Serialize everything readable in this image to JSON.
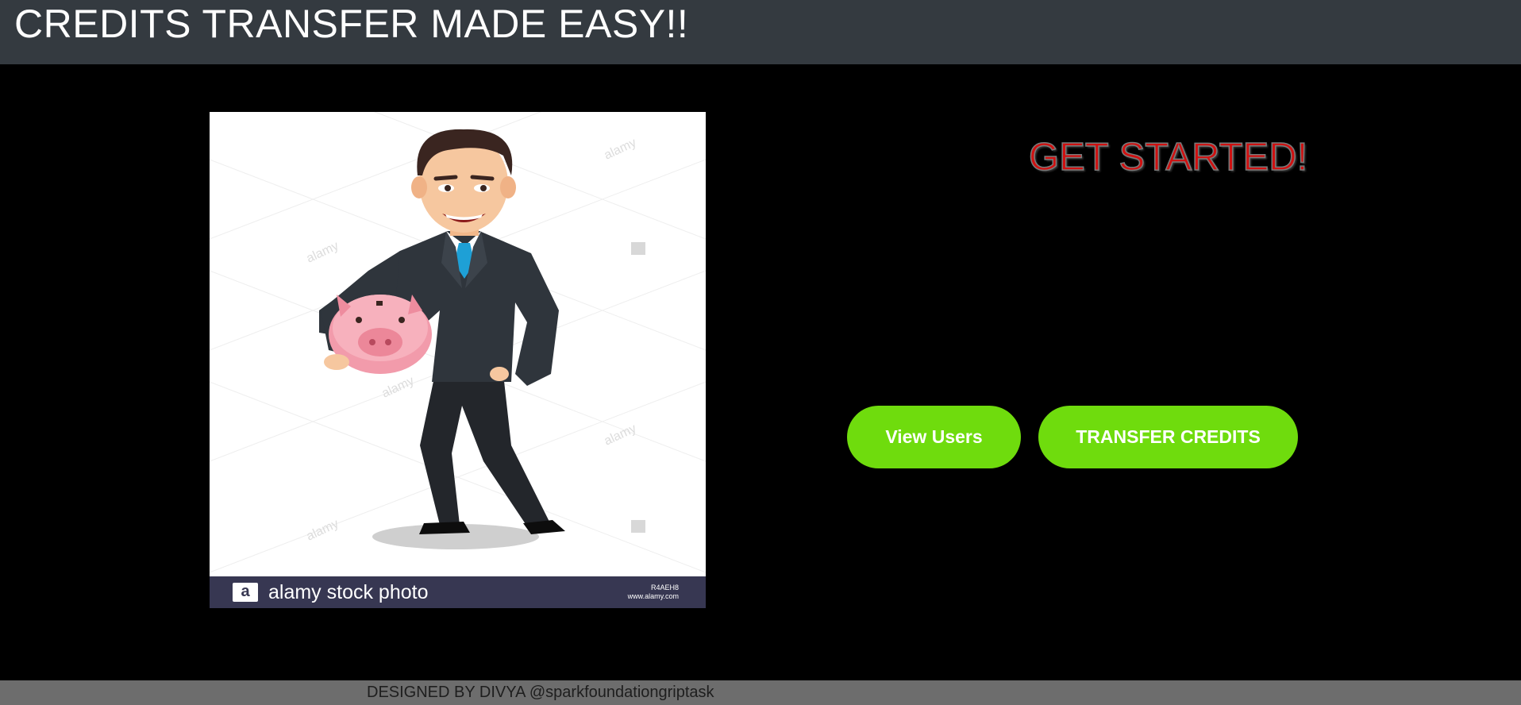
{
  "header": {
    "title": "CREDITS TRANSFER MADE EASY!!"
  },
  "hero_image": {
    "description_icon": "businessman-with-piggy-bank-illustration",
    "watermark_text": "alamy",
    "bar_logo": "a",
    "bar_text": "alamy stock photo",
    "bar_code": "R4AEH8",
    "bar_url": "www.alamy.com"
  },
  "main": {
    "heading": "GET STARTED!",
    "view_users_label": "View Users",
    "transfer_label": "TRANSFER CREDITS"
  },
  "footer": {
    "text": "DESIGNED BY DIVYA @sparkfoundationgriptask"
  },
  "colors": {
    "header_bg": "#343a40",
    "page_bg": "#000000",
    "button_bg": "#6fdc0d",
    "heading_color": "#d01010",
    "footer_bg": "#6d6d6d"
  }
}
